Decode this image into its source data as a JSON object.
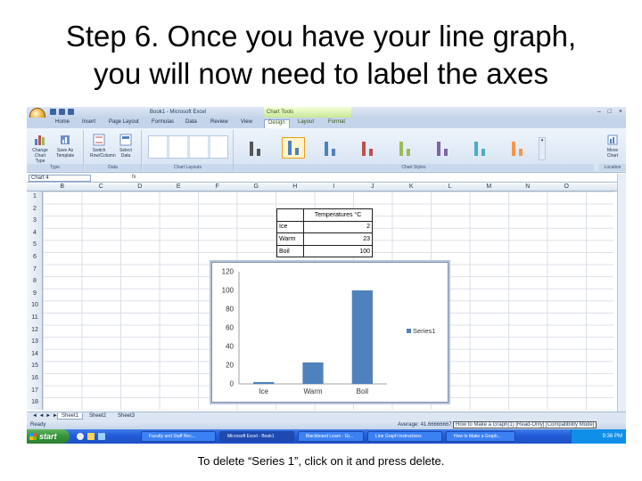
{
  "slide": {
    "title_line1": "Step 6. Once you have your line graph,",
    "title_line2": "you will now need to label the axes",
    "caption": "To delete “Series 1”, click on it and press delete."
  },
  "window": {
    "title": "Book1 - Microsoft Excel",
    "context_tab_header": "Chart Tools",
    "controls": [
      "–",
      "□",
      "×"
    ]
  },
  "ribbon": {
    "tabs": [
      "Home",
      "Insert",
      "Page Layout",
      "Formulas",
      "Data",
      "Review",
      "View",
      "Design",
      "Layout",
      "Format"
    ],
    "active_tab": "Design",
    "groups": {
      "type": {
        "label": "Type",
        "buttons": [
          {
            "label": "Change Chart Type"
          },
          {
            "label": "Save As Template"
          }
        ]
      },
      "data": {
        "label": "Data",
        "buttons": [
          {
            "label": "Switch Row/Column"
          },
          {
            "label": "Select Data"
          }
        ]
      },
      "chart_layouts": {
        "label": "Chart Layouts"
      },
      "chart_styles": {
        "label": "Chart Styles"
      },
      "location": {
        "label": "Location",
        "buttons": [
          {
            "label": "Move Chart"
          }
        ]
      }
    },
    "style_colors": [
      "#555555",
      "#4f81bd",
      "#4f81bd",
      "#c0504d",
      "#9bbb59",
      "#8064a2",
      "#4bacc6",
      "#f79646"
    ]
  },
  "namebox": {
    "value": "Chart 4",
    "fx_symbol": "fx"
  },
  "columns": [
    "B",
    "C",
    "D",
    "E",
    "F",
    "G",
    "H",
    "I",
    "J",
    "K",
    "L",
    "M",
    "N",
    "O"
  ],
  "rows": [
    "1",
    "2",
    "3",
    "4",
    "5",
    "6",
    "7",
    "8",
    "9",
    "10",
    "11",
    "12",
    "13",
    "14",
    "15",
    "16",
    "17",
    "18"
  ],
  "table": {
    "header": "Temperatures °C",
    "rows": [
      {
        "label": "Ice",
        "value": "2"
      },
      {
        "label": "Warm",
        "value": "23"
      },
      {
        "label": "Boil",
        "value": "100"
      }
    ]
  },
  "chart_data": {
    "type": "bar",
    "categories": [
      "Ice",
      "Warm",
      "Boil"
    ],
    "series": [
      {
        "name": "Series1",
        "values": [
          2,
          23,
          100
        ],
        "color": "#4f81bd"
      }
    ],
    "ylim": [
      0,
      120
    ],
    "yticks": [
      "0",
      "20",
      "40",
      "60",
      "80",
      "100",
      "120"
    ],
    "legend_position": "right",
    "gridlines": false
  },
  "sheet_tabs": {
    "nav": "◄ ◄ ► ►",
    "items": [
      "Sheet1",
      "Sheet2",
      "Sheet3"
    ],
    "active": "Sheet1"
  },
  "statusbar": {
    "ready": "Ready",
    "average": "Average: 41.66666667",
    "doc_title": "How to Make a Graph(1) [Read-Only] [Compatibility Mode]"
  },
  "taskbar": {
    "start_label": "start",
    "tasks": [
      {
        "label": "Faculty and Staff Rec..."
      },
      {
        "label": "Microsoft Excel - Book1"
      },
      {
        "label": "Blackboard Learn - Gr..."
      },
      {
        "label": "Line Graph Instructions"
      },
      {
        "label": "How to Make a Graph..."
      }
    ],
    "clock": "9:36 PM"
  }
}
